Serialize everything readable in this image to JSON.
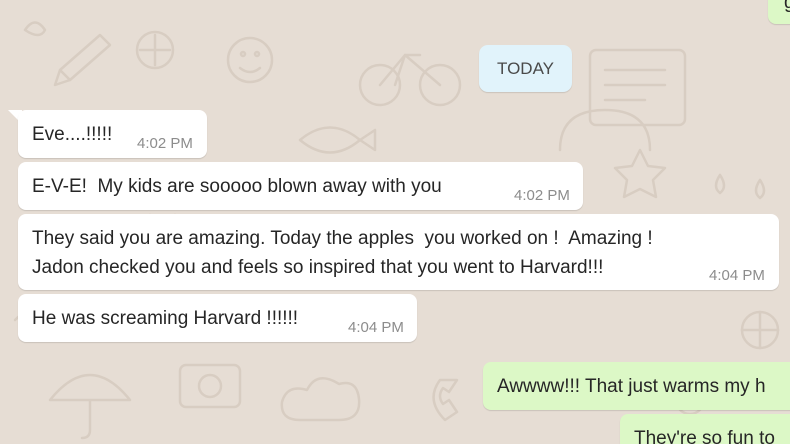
{
  "colors": {
    "wallpaper": "#e6ddd4",
    "incoming_bubble": "#ffffff",
    "outgoing_bubble": "#dcf8c6",
    "date_chip": "#e1f3fb",
    "timestamp": "#8c8c8c"
  },
  "date_separator": "TODAY",
  "messages": [
    {
      "direction": "in",
      "text": "Eve....!!!!!",
      "time": "4:02 PM"
    },
    {
      "direction": "in",
      "text": "E-V-E!  My kids are sooooo blown away with you",
      "time": "4:02 PM"
    },
    {
      "direction": "in",
      "lines": [
        "They said you are amazing. Today the apples  you worked on !  Amazing !",
        "Jadon checked you and feels so inspired that you went to Harvard!!!"
      ],
      "time": "4:04 PM"
    },
    {
      "direction": "in",
      "text": "He was screaming Harvard !!!!!!",
      "time": "4:04 PM"
    },
    {
      "direction": "out",
      "text": "Awwww!!! That just warms my h"
    },
    {
      "direction": "out",
      "text": "They're so fun to"
    }
  ],
  "top_right_fragment": "g"
}
